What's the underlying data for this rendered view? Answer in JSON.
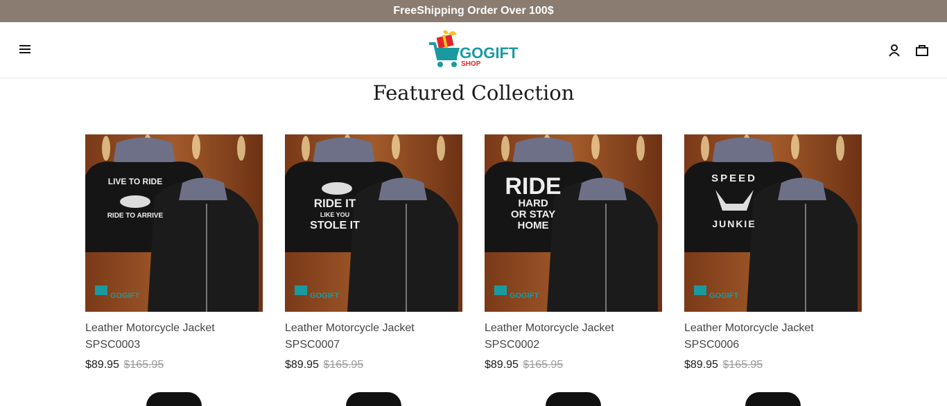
{
  "announcement": {
    "text": "FreeShipping Order Over 100$"
  },
  "header": {
    "logo": {
      "brand": "GOGIFT",
      "sub": "SHOP"
    },
    "icons": {
      "menu": "hamburger-menu-icon",
      "account": "user-icon",
      "cart": "shopping-bag-icon"
    }
  },
  "section": {
    "title": "Featured Collection"
  },
  "products": [
    {
      "title_line1": "Leather Motorcycle Jacket",
      "title_line2": "SPSC0003",
      "price": "$89.95",
      "compare_price": "$165.95",
      "print": "LIVE TO RIDE / RIDE TO ARRIVE"
    },
    {
      "title_line1": "Leather Motorcycle Jacket",
      "title_line2": "SPSC0007",
      "price": "$89.95",
      "compare_price": "$165.95",
      "print": "RIDE IT LIKE YOU STOLE IT"
    },
    {
      "title_line1": "Leather Motorcycle Jacket",
      "title_line2": "SPSC0002",
      "price": "$89.95",
      "compare_price": "$165.95",
      "print": "RIDE HARD OR STAY HOME"
    },
    {
      "title_line1": "Leather Motorcycle Jacket",
      "title_line2": "SPSC0006",
      "price": "$89.95",
      "compare_price": "$165.95",
      "print": "SPEED JUNKIE"
    }
  ],
  "colors": {
    "announcement_bg": "#8a7c70",
    "logo_teal": "#1a9aa0",
    "logo_red": "#e0262b"
  }
}
